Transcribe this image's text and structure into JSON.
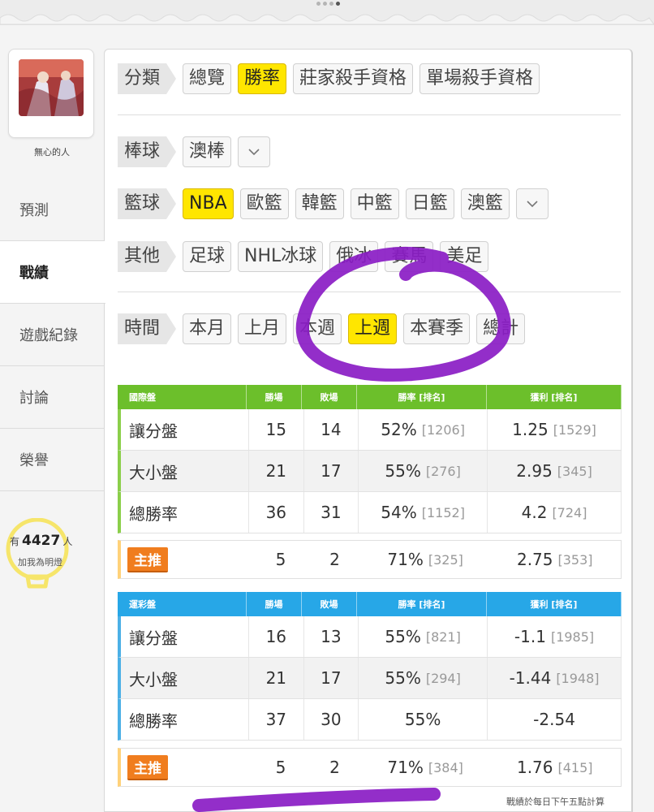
{
  "user": {
    "name": "無心的人"
  },
  "nav": {
    "items": [
      "預測",
      "戰績",
      "遊戲紀錄",
      "討論",
      "榮譽"
    ],
    "active": "戰績"
  },
  "fans": {
    "prefix": "有",
    "count": "4427",
    "suffix": "人",
    "cta": "加我為明燈"
  },
  "filters": {
    "category": {
      "label": "分類",
      "options": [
        "總覽",
        "勝率",
        "莊家殺手資格",
        "單場殺手資格"
      ],
      "selected": "勝率"
    },
    "baseball": {
      "label": "棒球",
      "options": [
        "澳棒"
      ]
    },
    "basketball": {
      "label": "籃球",
      "options": [
        "NBA",
        "歐籃",
        "韓籃",
        "中籃",
        "日籃",
        "澳籃"
      ],
      "selected": "NBA"
    },
    "other": {
      "label": "其他",
      "options": [
        "足球",
        "NHL冰球",
        "俄冰",
        "賽馬",
        "美足"
      ]
    },
    "time": {
      "label": "時間",
      "options": [
        "本月",
        "上月",
        "本週",
        "上週",
        "本賽季",
        "總計"
      ],
      "selected": "上週"
    }
  },
  "tables": {
    "international": {
      "title": "國際盤",
      "headers": [
        "勝場",
        "敗場",
        "勝率 [排名]",
        "獲利 [排名]"
      ],
      "rows": [
        {
          "label": "讓分盤",
          "wins": "15",
          "losses": "14",
          "rate": "52%",
          "rate_rank": "[1206]",
          "profit": "1.25",
          "profit_rank": "[1529]"
        },
        {
          "label": "大小盤",
          "wins": "21",
          "losses": "17",
          "rate": "55%",
          "rate_rank": "[276]",
          "profit": "2.95",
          "profit_rank": "[345]"
        },
        {
          "label": "總勝率",
          "wins": "36",
          "losses": "31",
          "rate": "54%",
          "rate_rank": "[1152]",
          "profit": "4.2",
          "profit_rank": "[724]"
        }
      ],
      "featured": {
        "label": "主推",
        "wins": "5",
        "losses": "2",
        "rate": "71%",
        "rate_rank": "[325]",
        "profit": "2.75",
        "profit_rank": "[353]"
      }
    },
    "lottery": {
      "title": "運彩盤",
      "headers": [
        "勝場",
        "敗場",
        "勝率 [排名]",
        "獲利 [排名]"
      ],
      "rows": [
        {
          "label": "讓分盤",
          "wins": "16",
          "losses": "13",
          "rate": "55%",
          "rate_rank": "[821]",
          "profit": "-1.1",
          "profit_rank": "[1985]"
        },
        {
          "label": "大小盤",
          "wins": "21",
          "losses": "17",
          "rate": "55%",
          "rate_rank": "[294]",
          "profit": "-1.44",
          "profit_rank": "[1948]"
        },
        {
          "label": "總勝率",
          "wins": "37",
          "losses": "30",
          "rate": "55%",
          "rate_rank": "",
          "profit": "-2.54",
          "profit_rank": ""
        }
      ],
      "featured": {
        "label": "主推",
        "wins": "5",
        "losses": "2",
        "rate": "71%",
        "rate_rank": "[384]",
        "profit": "1.76",
        "profit_rank": "[415]"
      }
    }
  },
  "footer_note": "戰績於每日下午五點計算",
  "colors": {
    "international_header": "#6cbf2b",
    "lottery_header": "#27a7e7",
    "selected_chip": "#ffe600",
    "badge": "#f07d1e",
    "marker": "#8a1cc4"
  }
}
